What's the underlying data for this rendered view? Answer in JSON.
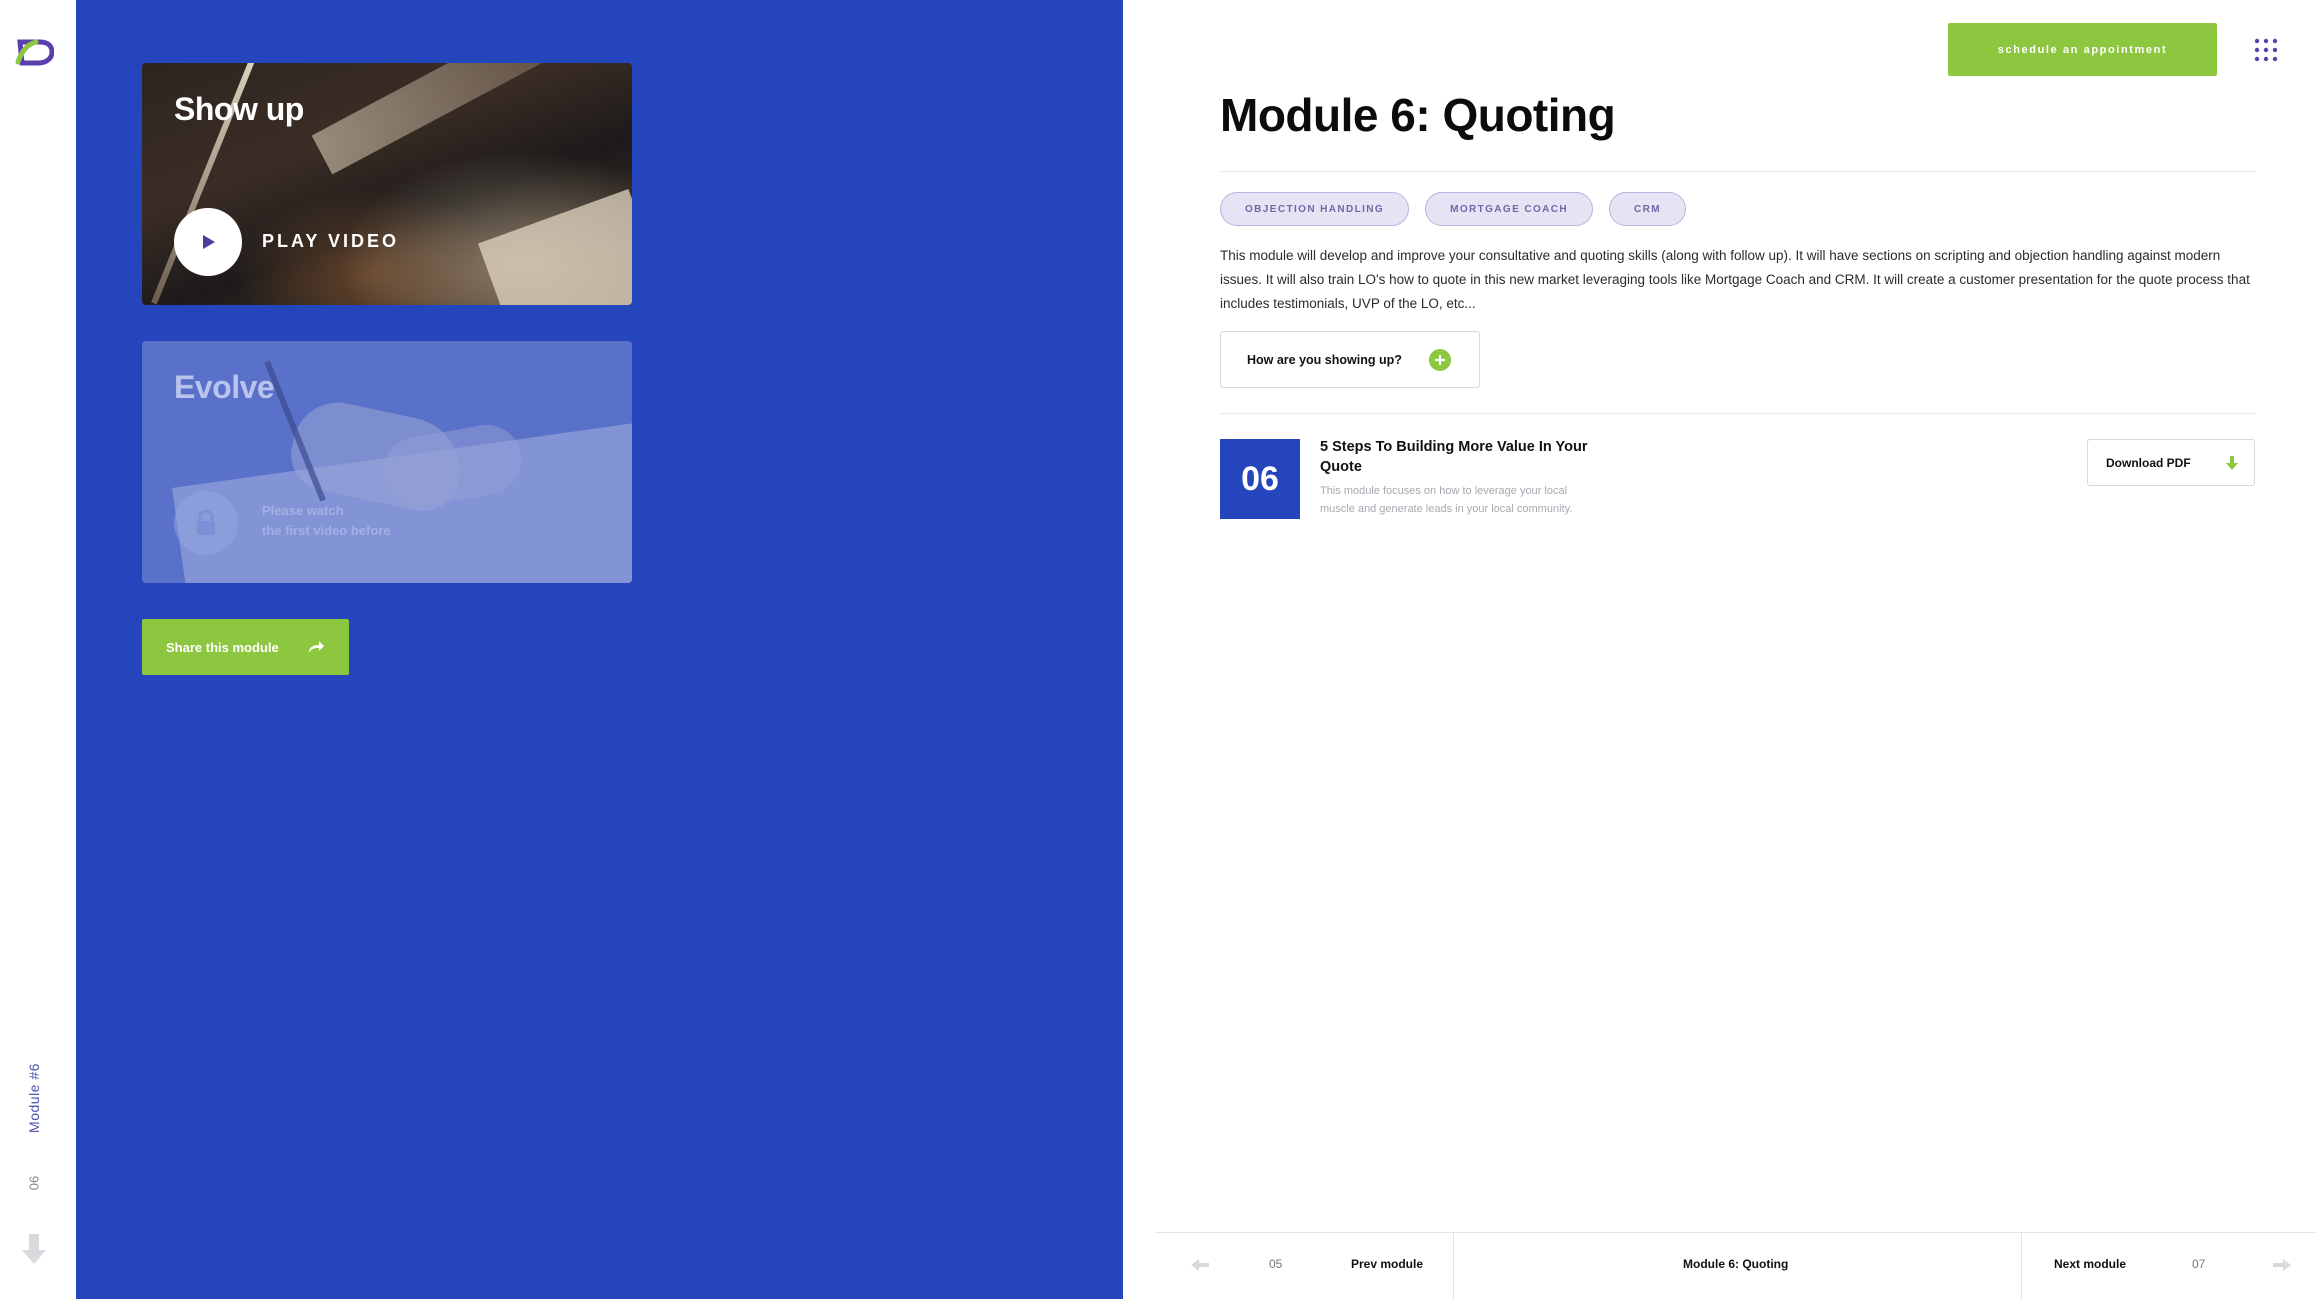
{
  "rail": {
    "module_label": "Module #6",
    "module_number": "06"
  },
  "cards": [
    {
      "title": "Show up",
      "action_label": "PLAY VIDEO"
    },
    {
      "title": "Evolve",
      "locked_line1": "Please watch",
      "locked_line2": "the first video before"
    }
  ],
  "share_label": "Share this module",
  "header": {
    "schedule_label": "schedule an appointment"
  },
  "content": {
    "title": "Module 6: Quoting",
    "tags": [
      "OBJECTION HANDLING",
      "MORTGAGE COACH",
      "CRM"
    ],
    "description": "This module will develop and improve your consultative and quoting skills (along with follow up). It will have sections on scripting and objection handling against modern issues. It will also train LO's how to quote in this new market leveraging tools like Mortgage Coach and CRM. It will create a customer presentation for the quote process that includes testimonials, UVP of the LO, etc...",
    "question_label": "How are you showing up?",
    "module_item": {
      "number": "06",
      "title": "5 Steps To Building More Value In Your Quote",
      "description": "This module focuses on how to leverage your local muscle and generate leads in your local community.",
      "download_label": "Download PDF"
    }
  },
  "bottom_nav": {
    "prev_number": "05",
    "prev_label": "Prev module",
    "current_label": "Module 6: Quoting",
    "next_label": "Next module",
    "next_number": "07"
  },
  "colors": {
    "primary_blue": "#2545bd",
    "accent_green": "#8dc63f",
    "tag_bg": "#e7e3f5",
    "logo_purple": "#5b3fae"
  },
  "icons": [
    "logo-icon",
    "play-icon",
    "lock-icon",
    "share-icon",
    "grid-menu-icon",
    "plus-icon",
    "download-icon",
    "arrow-left-icon",
    "arrow-right-icon",
    "arrow-down-icon"
  ]
}
